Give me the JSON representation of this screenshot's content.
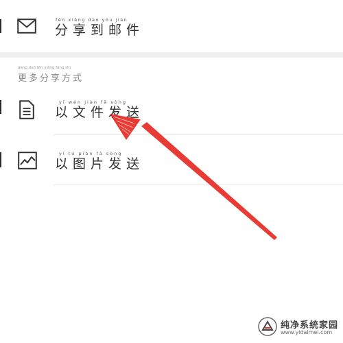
{
  "rows": {
    "email": {
      "label": "分享到邮件",
      "pinyin": "fēn  xiǎng dào  yóu  jiàn",
      "icon": "mail-icon"
    },
    "file": {
      "label": "以文件发送",
      "pinyin": "yǐ  wén  jiàn  fā  sòng",
      "icon": "document-icon"
    },
    "image": {
      "label": "以图片发送",
      "pinyin": "yǐ  tú  piàn  fā  sòng",
      "icon": "picture-icon"
    }
  },
  "section": {
    "title": "更多分享方式",
    "pinyin": "gèng duō fēn xiǎng fāng shì"
  },
  "annotation": {
    "type": "red-arrow",
    "color": "#e8302a",
    "points_to": "以文件发送"
  },
  "watermark": {
    "title": "纯净系统家园",
    "url": "www.yidaimei.com",
    "icon": "watermark-logo"
  },
  "colors": {
    "text": "#333333",
    "section_gap": "#f0f0f0",
    "arrow": "#e8302a"
  }
}
